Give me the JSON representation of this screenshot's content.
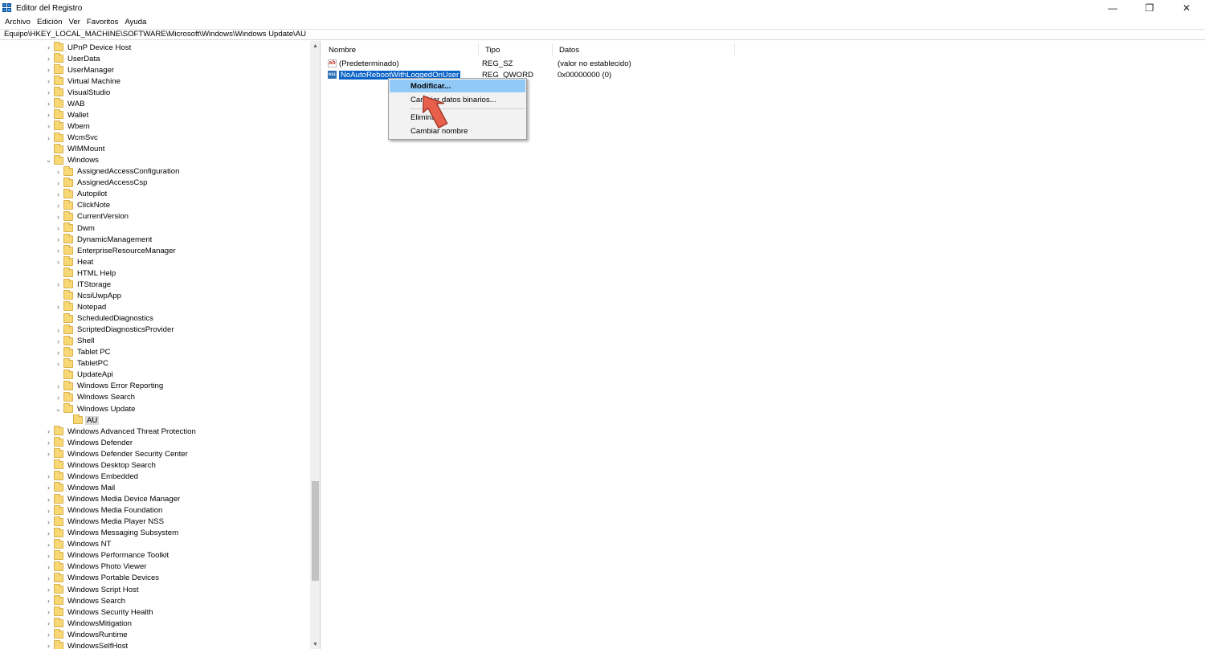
{
  "window": {
    "title": "Editor del Registro",
    "minimize": "—",
    "restore": "❐",
    "close": "✕"
  },
  "menu": [
    "Archivo",
    "Edición",
    "Ver",
    "Favoritos",
    "Ayuda"
  ],
  "address": "Equipo\\HKEY_LOCAL_MACHINE\\SOFTWARE\\Microsoft\\Windows\\Windows Update\\AU",
  "tree": [
    {
      "label": "UPnP Device Host",
      "level": 0,
      "expander": "collapsed"
    },
    {
      "label": "UserData",
      "level": 0,
      "expander": "collapsed"
    },
    {
      "label": "UserManager",
      "level": 0,
      "expander": "collapsed"
    },
    {
      "label": "Virtual Machine",
      "level": 0,
      "expander": "collapsed"
    },
    {
      "label": "VisualStudio",
      "level": 0,
      "expander": "collapsed"
    },
    {
      "label": "WAB",
      "level": 0,
      "expander": "collapsed"
    },
    {
      "label": "Wallet",
      "level": 0,
      "expander": "collapsed"
    },
    {
      "label": "Wbem",
      "level": 0,
      "expander": "collapsed"
    },
    {
      "label": "WcmSvc",
      "level": 0,
      "expander": "collapsed"
    },
    {
      "label": "WIMMount",
      "level": 0,
      "expander": "none"
    },
    {
      "label": "Windows",
      "level": 0,
      "expander": "expanded"
    },
    {
      "label": "AssignedAccessConfiguration",
      "level": 1,
      "expander": "collapsed"
    },
    {
      "label": "AssignedAccessCsp",
      "level": 1,
      "expander": "collapsed"
    },
    {
      "label": "Autopilot",
      "level": 1,
      "expander": "collapsed"
    },
    {
      "label": "ClickNote",
      "level": 1,
      "expander": "collapsed"
    },
    {
      "label": "CurrentVersion",
      "level": 1,
      "expander": "collapsed"
    },
    {
      "label": "Dwm",
      "level": 1,
      "expander": "collapsed"
    },
    {
      "label": "DynamicManagement",
      "level": 1,
      "expander": "collapsed"
    },
    {
      "label": "EnterpriseResourceManager",
      "level": 1,
      "expander": "collapsed"
    },
    {
      "label": "Heat",
      "level": 1,
      "expander": "collapsed"
    },
    {
      "label": "HTML Help",
      "level": 1,
      "expander": "none"
    },
    {
      "label": "ITStorage",
      "level": 1,
      "expander": "collapsed"
    },
    {
      "label": "NcsiUwpApp",
      "level": 1,
      "expander": "none"
    },
    {
      "label": "Notepad",
      "level": 1,
      "expander": "collapsed"
    },
    {
      "label": "ScheduledDiagnostics",
      "level": 1,
      "expander": "none"
    },
    {
      "label": "ScriptedDiagnosticsProvider",
      "level": 1,
      "expander": "collapsed"
    },
    {
      "label": "Shell",
      "level": 1,
      "expander": "collapsed"
    },
    {
      "label": "Tablet PC",
      "level": 1,
      "expander": "collapsed"
    },
    {
      "label": "TabletPC",
      "level": 1,
      "expander": "collapsed"
    },
    {
      "label": "UpdateApi",
      "level": 1,
      "expander": "none"
    },
    {
      "label": "Windows Error Reporting",
      "level": 1,
      "expander": "collapsed"
    },
    {
      "label": "Windows Search",
      "level": 1,
      "expander": "collapsed"
    },
    {
      "label": "Windows Update",
      "level": 1,
      "expander": "expanded"
    },
    {
      "label": "AU",
      "level": 2,
      "expander": "none",
      "selected": true
    },
    {
      "label": "Windows Advanced Threat Protection",
      "level": 0,
      "expander": "collapsed"
    },
    {
      "label": "Windows Defender",
      "level": 0,
      "expander": "collapsed"
    },
    {
      "label": "Windows Defender Security Center",
      "level": 0,
      "expander": "collapsed"
    },
    {
      "label": "Windows Desktop Search",
      "level": 0,
      "expander": "none"
    },
    {
      "label": "Windows Embedded",
      "level": 0,
      "expander": "collapsed"
    },
    {
      "label": "Windows Mail",
      "level": 0,
      "expander": "collapsed"
    },
    {
      "label": "Windows Media Device Manager",
      "level": 0,
      "expander": "collapsed"
    },
    {
      "label": "Windows Media Foundation",
      "level": 0,
      "expander": "collapsed"
    },
    {
      "label": "Windows Media Player NSS",
      "level": 0,
      "expander": "collapsed"
    },
    {
      "label": "Windows Messaging Subsystem",
      "level": 0,
      "expander": "collapsed"
    },
    {
      "label": "Windows NT",
      "level": 0,
      "expander": "collapsed"
    },
    {
      "label": "Windows Performance Toolkit",
      "level": 0,
      "expander": "collapsed"
    },
    {
      "label": "Windows Photo Viewer",
      "level": 0,
      "expander": "collapsed"
    },
    {
      "label": "Windows Portable Devices",
      "level": 0,
      "expander": "collapsed"
    },
    {
      "label": "Windows Script Host",
      "level": 0,
      "expander": "collapsed"
    },
    {
      "label": "Windows Search",
      "level": 0,
      "expander": "collapsed"
    },
    {
      "label": "Windows Security Health",
      "level": 0,
      "expander": "collapsed"
    },
    {
      "label": "WindowsMitigation",
      "level": 0,
      "expander": "collapsed"
    },
    {
      "label": "WindowsRuntime",
      "level": 0,
      "expander": "collapsed"
    },
    {
      "label": "WindowsSelfHost",
      "level": 0,
      "expander": "collapsed"
    }
  ],
  "columns": {
    "name": "Nombre",
    "type": "Tipo",
    "data": "Datos"
  },
  "values": [
    {
      "icon": "string-value-icon",
      "glyph": "ab",
      "name": "(Predeterminado)",
      "type": "REG_SZ",
      "data": "(valor no establecido)",
      "selected": false
    },
    {
      "icon": "binary-value-icon",
      "glyph": "011",
      "name": "NoAutoRebootWithLoggedOnUser",
      "type": "REG_QWORD",
      "data": "0x00000000 (0)",
      "selected": true
    }
  ],
  "context_menu": {
    "modify": "Modificar...",
    "modify_binary": "Cambiar datos binarios...",
    "delete": "Eliminar",
    "rename": "Cambiar nombre"
  },
  "colors": {
    "selection": "#0a64c8",
    "menu_highlight": "#91c9f7",
    "folder": "#f8d775",
    "pointer": "#e8604c"
  }
}
